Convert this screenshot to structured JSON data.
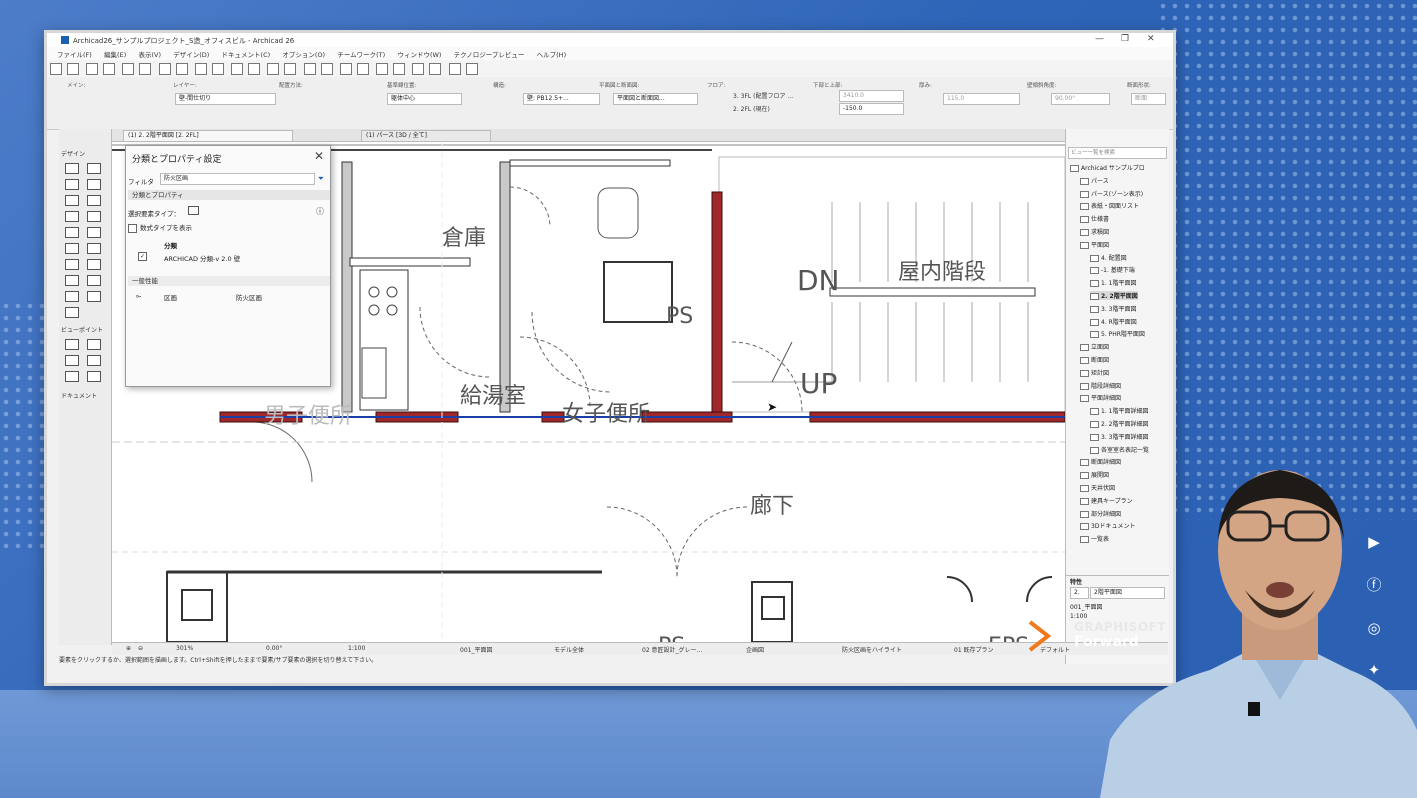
{
  "window": {
    "title": "Archicad26_サンプルプロジェクト_S造_オフィスビル - Archicad 26"
  },
  "menu": [
    "ファイル(F)",
    "編集(E)",
    "表示(V)",
    "デザイン(D)",
    "ドキュメント(C)",
    "オプション(O)",
    "チームワーク(T)",
    "ウィンドウ(W)",
    "テクノロジープレビュー",
    "ヘルプ(H)"
  ],
  "infobox": {
    "main_label": "メイン:",
    "layer_label": "レイヤー:",
    "layer_value": "壁-間仕切り",
    "geometry_label": "配置方法:",
    "ref_label": "基準線位置:",
    "ref_value": "躯体中心",
    "structure_label": "構造:",
    "structure_value": "壁: PB12.5+...",
    "plan_label": "平面図と断面図:",
    "plan_value": "平面図と断面図...",
    "story_label": "フロア:",
    "story_top": "3. 3FL (配置フロア ...",
    "story_bottom": "2. 2FL (現在)",
    "topbottom_label": "下部と上部:",
    "top_value": "3410.0",
    "bottom_value": "-150.0",
    "thickness_label": "厚み:",
    "thickness_value": "115.0",
    "angle_label": "壁傾斜角度:",
    "angle_value": "90.00°",
    "section_label": "断面形状:",
    "section_value": "断面"
  },
  "tabs": [
    {
      "label": "(1) 2. 2階平面図 [2. 2FL]"
    },
    {
      "label": "(1) パース [3D / 全て]"
    }
  ],
  "toolbox": {
    "design_label": "デザイン",
    "viewpoint_label": "ビューポイント",
    "document_label": "ドキュメント"
  },
  "dialog": {
    "title": "分類とプロパティ設定",
    "filter_label": "フィルタ",
    "filter_value": "防火区画",
    "section_title": "分類とプロパティ",
    "element_type_label": "選択要素タイプ：",
    "show_multiple": "数式タイプを表示",
    "classification_header": "分類",
    "classification_value": "ARCHICAD 分類-v 2.0 壁",
    "general_header": "一般性能",
    "prop_name": "区画",
    "prop_value": "防火区画"
  },
  "rooms": {
    "storage": "倉庫",
    "dn": "DN",
    "stairs": "屋内階段",
    "ps1": "PS",
    "up": "UP",
    "kitchen": "給湯室",
    "womens": "女子便所",
    "mens_partial": "男子便所",
    "corridor": "廊下",
    "ps2": "PS",
    "eps": "EPS"
  },
  "navigator": {
    "search_placeholder": "ビュー一覧を検索",
    "items": [
      {
        "label": "Archicad サンプルプロ",
        "level": 0
      },
      {
        "label": "パース",
        "level": 1
      },
      {
        "label": "パース(ゾーン表示)",
        "level": 1
      },
      {
        "label": "表紙・図面リスト",
        "level": 1
      },
      {
        "label": "仕様書",
        "level": 1
      },
      {
        "label": "求積図",
        "level": 1
      },
      {
        "label": "平面図",
        "level": 1
      },
      {
        "label": "4. 配置図",
        "level": 2
      },
      {
        "label": "-1. 基礎下端",
        "level": 2
      },
      {
        "label": "1. 1階平面図",
        "level": 2
      },
      {
        "label": "2. 2階平面図",
        "level": 2,
        "selected": true
      },
      {
        "label": "3. 3階平面図",
        "level": 2
      },
      {
        "label": "4. R階平面図",
        "level": 2
      },
      {
        "label": "5. PHR階平面図",
        "level": 2
      },
      {
        "label": "立面図",
        "level": 1
      },
      {
        "label": "断面図",
        "level": 1
      },
      {
        "label": "矩計図",
        "level": 1
      },
      {
        "label": "階段詳細図",
        "level": 1
      },
      {
        "label": "平面詳細図",
        "level": 1
      },
      {
        "label": "1. 1階平面詳細図",
        "level": 2
      },
      {
        "label": "2. 2階平面詳細図",
        "level": 2
      },
      {
        "label": "3. 3階平面詳細図",
        "level": 2
      },
      {
        "label": "各室室名表記一覧",
        "level": 2
      },
      {
        "label": "断面詳細図",
        "level": 1
      },
      {
        "label": "展開図",
        "level": 1
      },
      {
        "label": "天井伏図",
        "level": 1
      },
      {
        "label": "建具キープラン",
        "level": 1
      },
      {
        "label": "部分詳細図",
        "level": 1
      },
      {
        "label": "3Dドキュメント",
        "level": 1
      },
      {
        "label": "一覧表",
        "level": 1
      }
    ],
    "properties_label": "特性",
    "prop_id": "2.",
    "prop_name": "2階平面図",
    "prop_layer": "001_平面図",
    "prop_scale": "1:100"
  },
  "statusbar": {
    "zoom": "301%",
    "angle": "0.00°",
    "scale": "1:100",
    "layer": "001_平面図",
    "model": "モデル全体",
    "structure": "02 意匠設計_グレー...",
    "plan": "企画図",
    "highlight": "防火区画をハイライト",
    "renovation": "01 既存プラン",
    "default": "デフォルト"
  },
  "hint": "要素をクリックするか、選択範囲を描画します。Ctrl+Shiftを押したままで要素/サブ要素の選択を切り替えて下さい。",
  "logo": {
    "brand": "GRAPHISOFT",
    "event": "Forward"
  },
  "colors": {
    "fire_wall": "#a0282a",
    "fire_line": "#1b3fa8",
    "wall": "#b5b5b5"
  }
}
